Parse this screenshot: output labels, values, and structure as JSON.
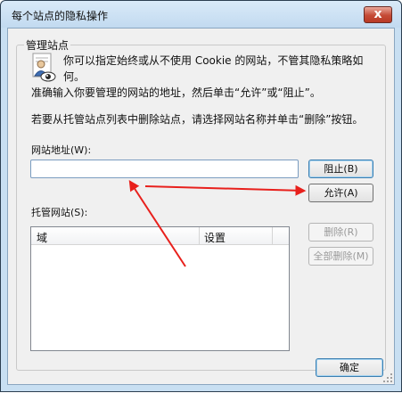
{
  "window": {
    "title": "每个站点的隐私操作",
    "close_glyph": "x"
  },
  "group": {
    "label": "管理站点"
  },
  "info": {
    "line1": "你可以指定始终或从不使用 Cookie 的网站，不管其隐私策略如",
    "line2": "何。",
    "line3": "准确输入你要管理的网站的地址，然后单击“允许”或“阻止”。",
    "line4": "若要从托管站点列表中删除站点，请选择网站名称并单击“删除”按钮。"
  },
  "address": {
    "label": "网站地址(W):",
    "value": "",
    "placeholder": ""
  },
  "buttons": {
    "block": "阻止(B)",
    "allow": "允许(A)",
    "remove": "删除(R)",
    "remove_all": "全部删除(M)",
    "ok": "确定"
  },
  "managed": {
    "label": "托管网站(S):",
    "columns": [
      "域",
      "设置"
    ],
    "rows": []
  },
  "colors": {
    "accent": "#3c7fb1",
    "annotation_arrow": "#e8201c",
    "close": "#c54a36"
  },
  "icons": {
    "privacy": "privacy-person-eye-icon",
    "close": "close-icon",
    "resize": "resize-grip-icon"
  }
}
